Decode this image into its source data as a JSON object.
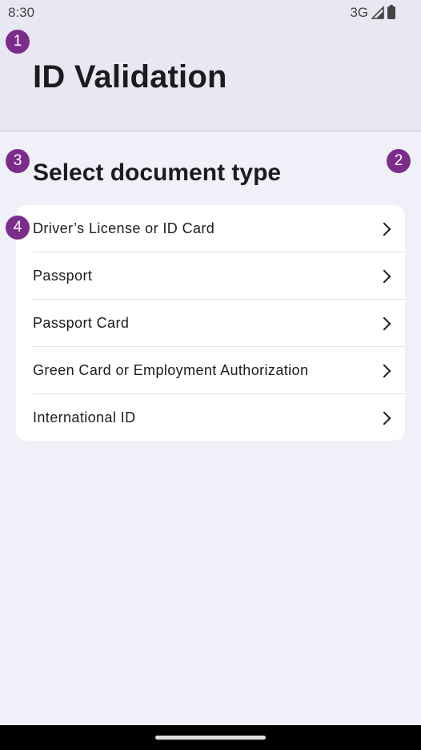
{
  "status_bar": {
    "time": "8:30",
    "network": "3G"
  },
  "header": {
    "title": "ID Validation"
  },
  "section": {
    "title": "Select document type"
  },
  "badges": [
    "1",
    "2",
    "3",
    "4"
  ],
  "documents": [
    {
      "label": "Driver’s License or ID Card",
      "icon": "chevron-right-icon"
    },
    {
      "label": "Passport",
      "icon": "chevron-right-icon"
    },
    {
      "label": "Passport Card",
      "icon": "chevron-right-icon"
    },
    {
      "label": "Green Card or Employment Authorization",
      "icon": "chevron-right-icon"
    },
    {
      "label": "International ID",
      "icon": "chevron-right-icon"
    }
  ],
  "colors": {
    "badge": "#7c2d8b",
    "header_bg": "#e8e8f2",
    "page_bg": "#f0f0f8"
  }
}
